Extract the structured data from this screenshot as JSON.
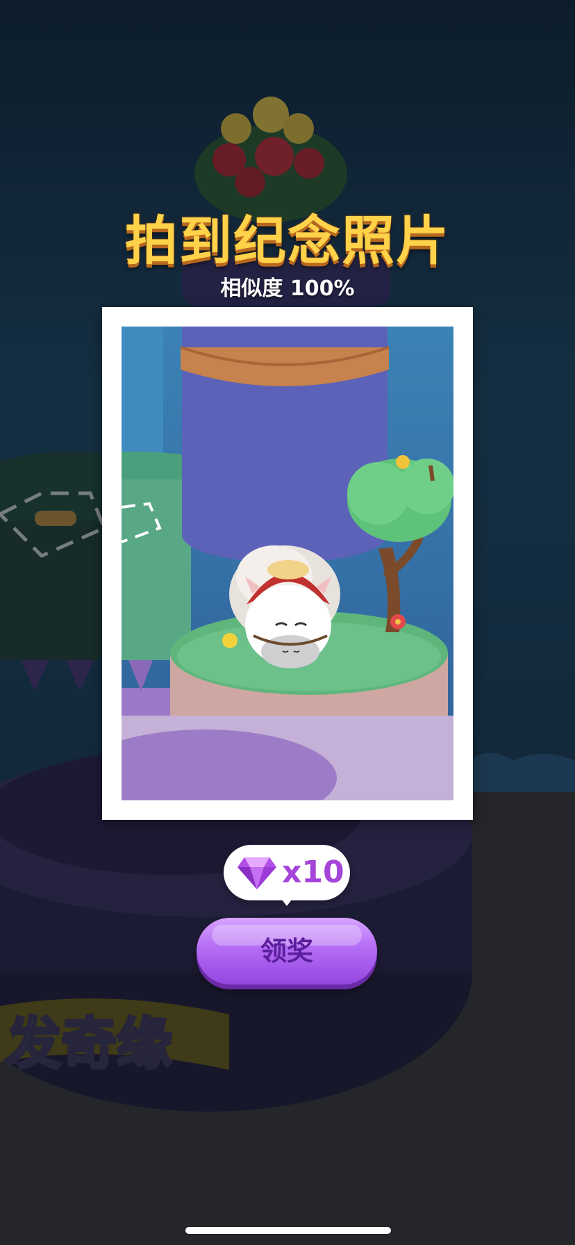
{
  "modal": {
    "title": "拍到纪念照片",
    "similarity": "相似度 100%"
  },
  "background": {
    "banner_text": "发奇缘"
  },
  "reward": {
    "icon": "gem-icon",
    "count": "x10"
  },
  "claim_button": {
    "label": "领奖"
  },
  "colors": {
    "title": "#ffd24a",
    "button": "#b46cf4",
    "reward_text": "#a444d8"
  }
}
